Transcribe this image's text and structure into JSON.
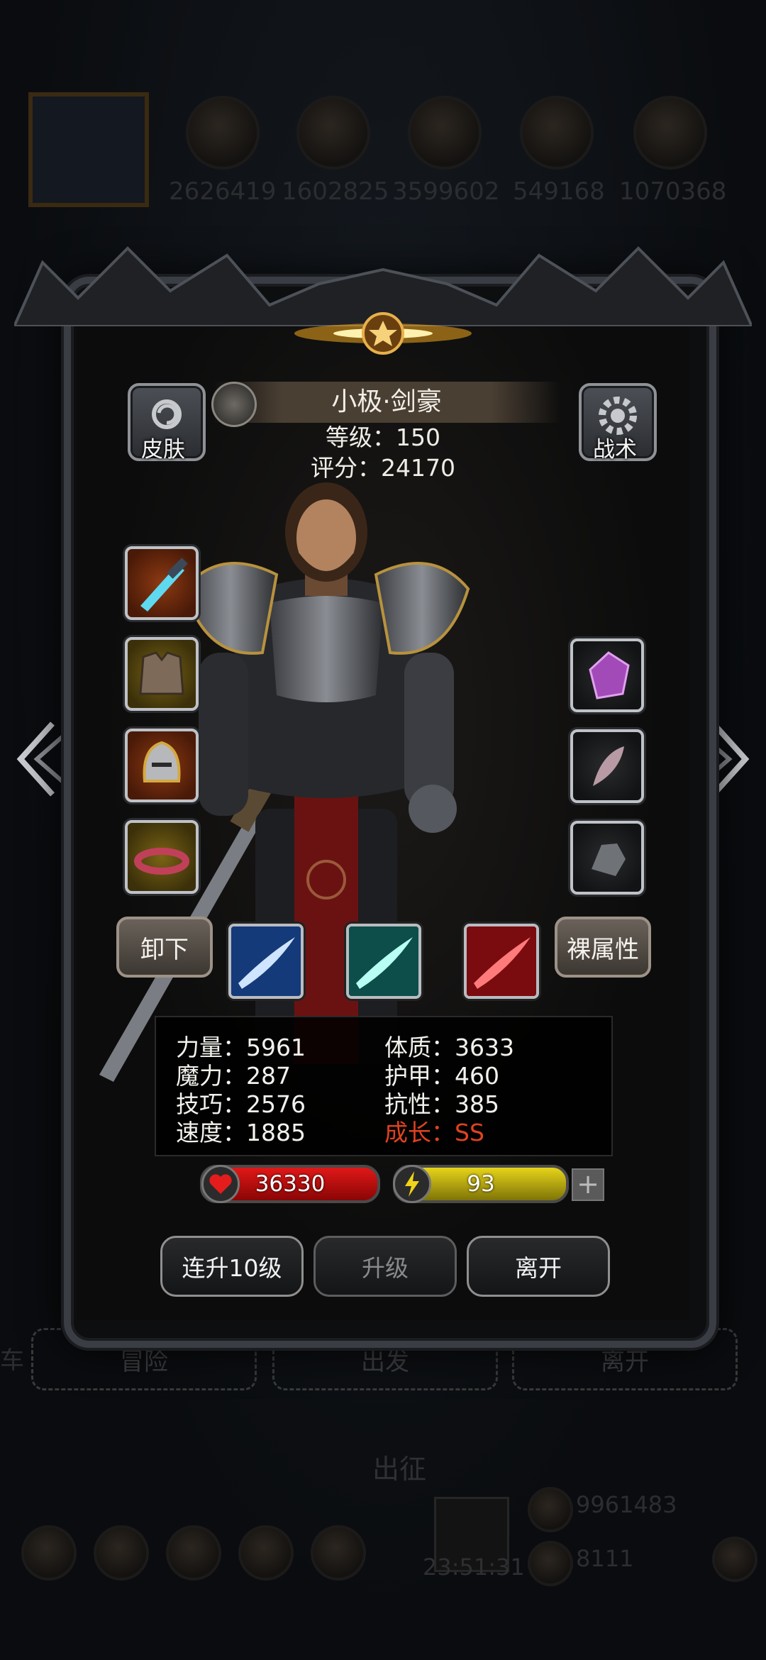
{
  "background": {
    "resources": [
      "2626419",
      "1602825",
      "3599602",
      "549168",
      "1070368"
    ],
    "nav_buttons": [
      "冒险",
      "出发",
      "离开"
    ],
    "left_edge_text": "车",
    "title_below": "出征",
    "gold": "9961483",
    "gems": "8111",
    "clock": "23:51:31"
  },
  "hero": {
    "name": "小极·剑豪",
    "level_label": "等级：150",
    "score_label": "评分：24170"
  },
  "buttons": {
    "skin": "皮肤",
    "tactics": "战术",
    "unequip": "卸下",
    "naked_stats": "裸属性",
    "upgrade10": "连升10级",
    "upgrade": "升级",
    "leave": "离开"
  },
  "stats": {
    "strength": "力量：5961",
    "constitution": "体质：3633",
    "magic": "魔力：287",
    "armor": "护甲：460",
    "skill": "技巧：2576",
    "resistance": "抗性：385",
    "speed": "速度：1885",
    "growth": "成长：SS"
  },
  "bars": {
    "hp": "36330",
    "energy": "93",
    "plus": "+"
  },
  "colors": {
    "growth": "#e0421f",
    "hp": "#d91515",
    "energy": "#e0cf18"
  }
}
